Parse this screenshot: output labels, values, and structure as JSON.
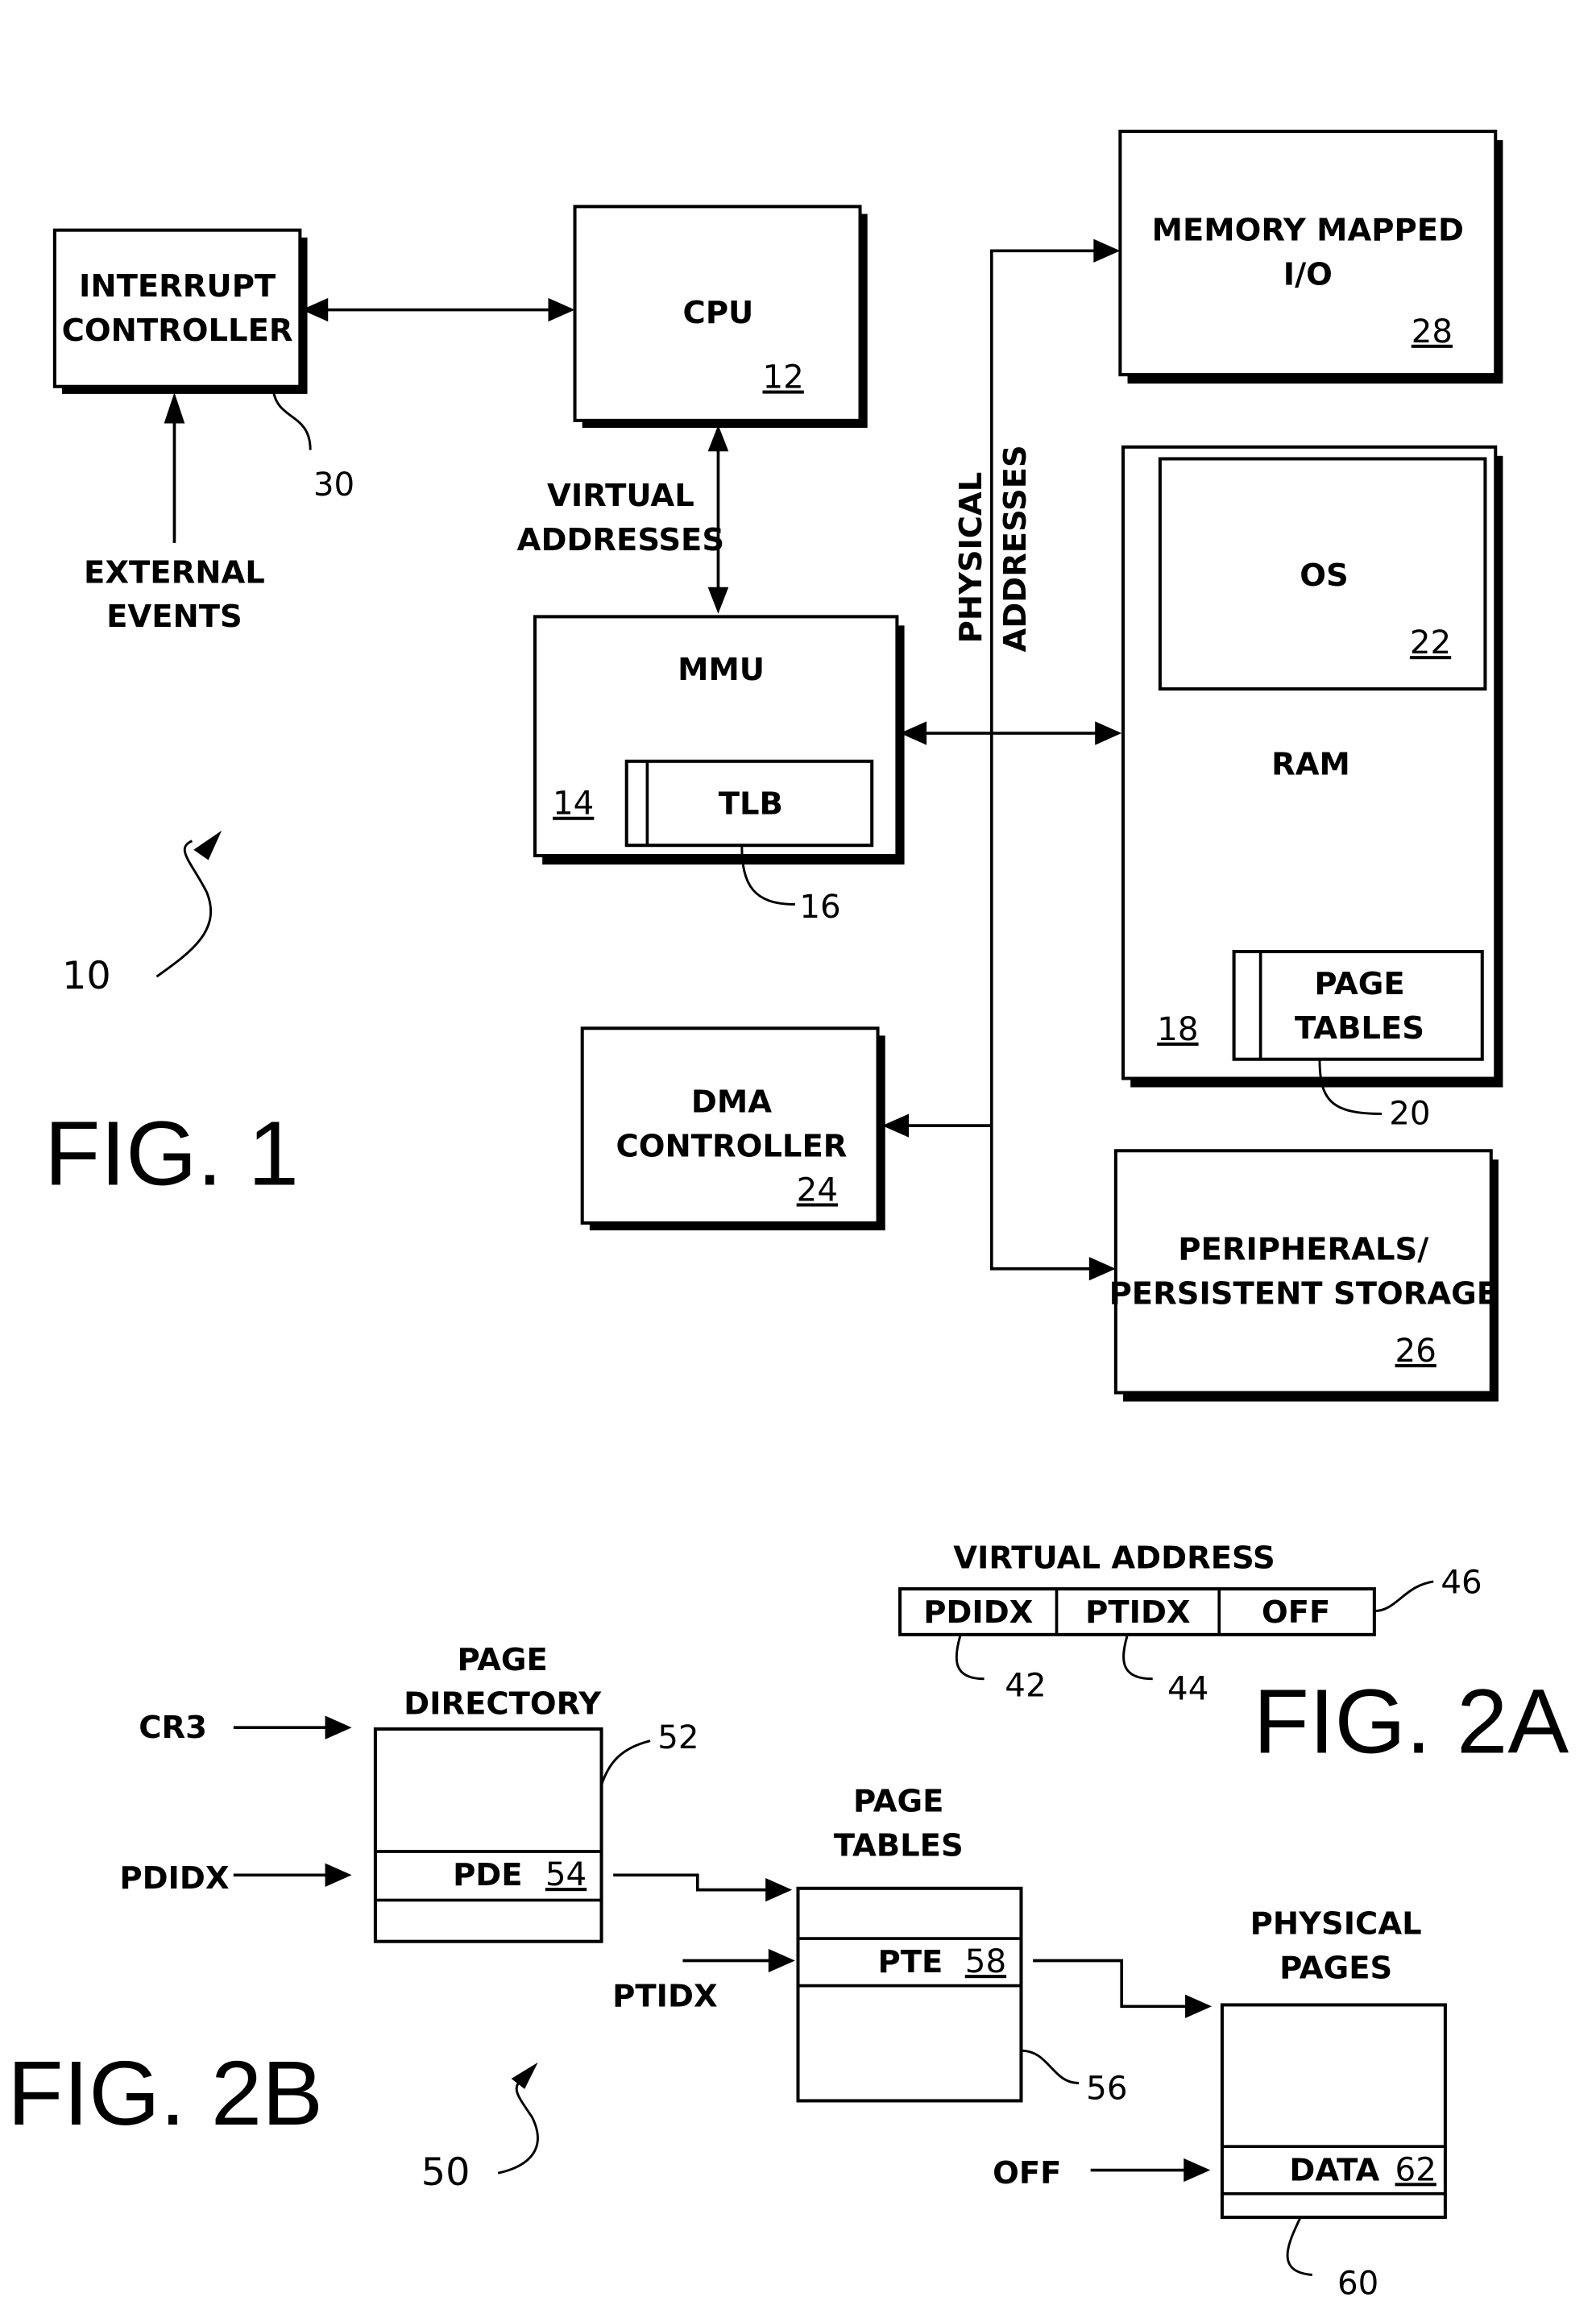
{
  "figure1": {
    "caption": "FIG. 1",
    "system_ref": "10",
    "interrupt_controller": {
      "line1": "INTERRUPT",
      "line2": "CONTROLLER",
      "ref": "30"
    },
    "external_events": {
      "line1": "EXTERNAL",
      "line2": "EVENTS"
    },
    "cpu": {
      "label": "CPU",
      "ref": "12"
    },
    "virtual_addresses": {
      "line1": "VIRTUAL",
      "line2": "ADDRESSES"
    },
    "mmu": {
      "label": "MMU",
      "ref": "14"
    },
    "tlb": {
      "label": "TLB",
      "ref": "16"
    },
    "physical_addresses": {
      "line1": "PHYSICAL",
      "line2": "ADDRESSES"
    },
    "memory_mapped_io": {
      "line1": "MEMORY MAPPED",
      "line2": "I/O",
      "ref": "28"
    },
    "ram": {
      "label": "RAM",
      "ref": "18"
    },
    "os": {
      "label": "OS",
      "ref": "22"
    },
    "page_tables": {
      "line1": "PAGE",
      "line2": "TABLES",
      "ref": "20"
    },
    "dma_controller": {
      "line1": "DMA",
      "line2": "CONTROLLER",
      "ref": "24"
    },
    "peripherals": {
      "line1": "PERIPHERALS/",
      "line2": "PERSISTENT STORAGE",
      "ref": "26"
    }
  },
  "figure2a": {
    "caption": "FIG. 2A",
    "title": "VIRTUAL ADDRESS",
    "fields": [
      {
        "label": "PDIDX",
        "ref": "42"
      },
      {
        "label": "PTIDX",
        "ref": "44"
      },
      {
        "label": "OFF",
        "ref": ""
      }
    ],
    "address_ref": "46"
  },
  "figure2b": {
    "caption": "FIG. 2B",
    "system_ref": "50",
    "inputs": {
      "cr3": "CR3",
      "pdidx": "PDIDX",
      "ptidx": "PTIDX",
      "off": "OFF"
    },
    "page_directory": {
      "line1": "PAGE",
      "line2": "DIRECTORY",
      "ref": "52",
      "entry": "PDE",
      "entry_ref": "54"
    },
    "page_tables": {
      "line1": "PAGE",
      "line2": "TABLES",
      "ref": "56",
      "entry": "PTE",
      "entry_ref": "58"
    },
    "physical_pages": {
      "line1": "PHYSICAL",
      "line2": "PAGES",
      "ref": "60",
      "entry": "DATA",
      "entry_ref": "62"
    }
  }
}
